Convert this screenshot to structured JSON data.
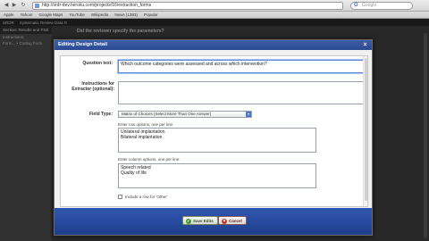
{
  "browser": {
    "url": "http://srdr-dev.heroku.com/projects/16/extraction_forms",
    "search_placeholder": "Google",
    "bookmarks": [
      "Apple",
      "Yahoo!",
      "Google Maps",
      "YouTube",
      "Wikipedia",
      "News (1383)",
      "Popular"
    ]
  },
  "page": {
    "tabs": [
      "SRDR",
      "Systematic Review Data R"
    ],
    "sidebar": {
      "lines": [
        "Section: Results and PSE",
        "Instructions:",
        "Form... • Coding Form"
      ]
    },
    "question_header": "Did the reviewer specify the parameters?"
  },
  "dialog": {
    "title": "Editing Design Detail",
    "close_label": "×",
    "question_label": "Question text:",
    "question_value": "Which outcome categories were assessed and across which intervention?",
    "instructions_label": "Instructions for Extractor (optional):",
    "instructions_value": "",
    "field_type_label": "Field Type:",
    "field_type_value": "Matrix of Choices (Select More Than One Answer)",
    "row_options_hint": "Enter row options, one per line:",
    "row_options": [
      "Unilateral implantation",
      "Bilateral implantation"
    ],
    "column_options_hint": "Enter column options, one per line:",
    "column_options": [
      "Speech related",
      "Quality of life"
    ],
    "other_checkbox_label": "Include a row for 'Other'",
    "save_label": "Save Edits",
    "cancel_label": "Cancel"
  }
}
